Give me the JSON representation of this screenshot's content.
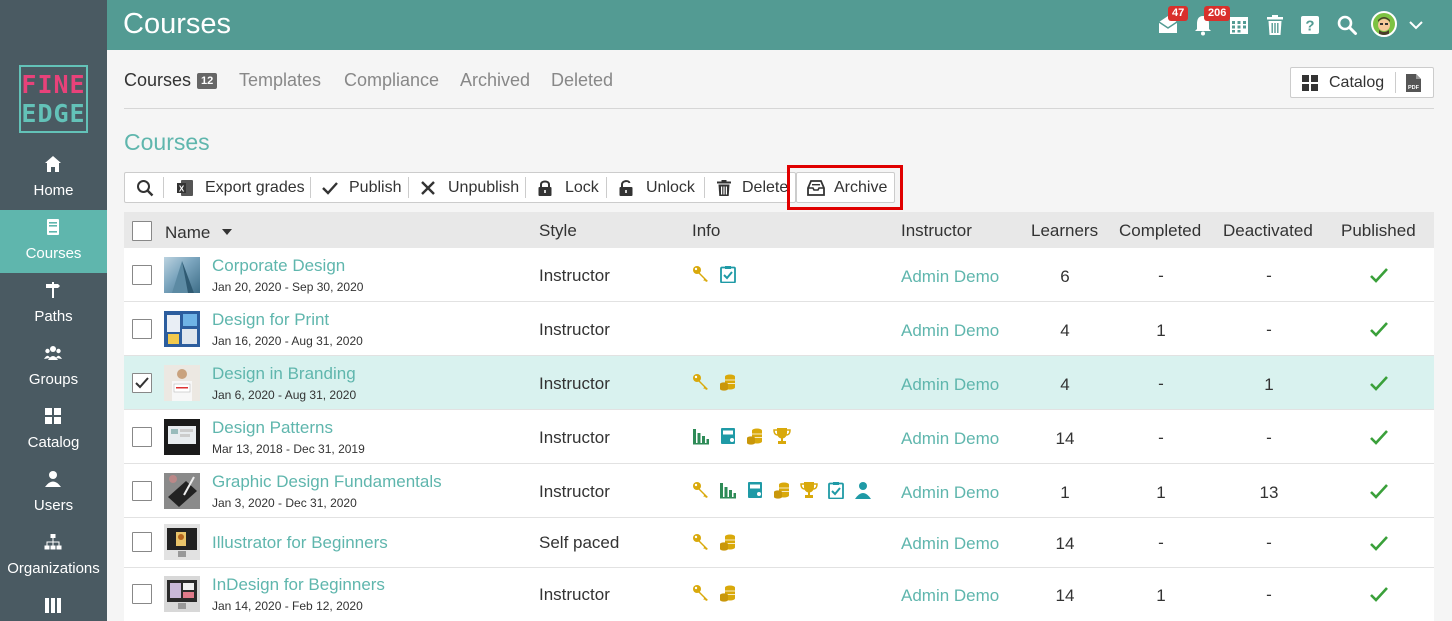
{
  "app": {
    "title": "Courses"
  },
  "logo": {
    "line1": "FINE",
    "line2": "EDGE"
  },
  "sidebar": {
    "items": [
      {
        "label": "Home",
        "icon": "home-icon"
      },
      {
        "label": "Courses",
        "icon": "book-icon",
        "active": true
      },
      {
        "label": "Paths",
        "icon": "signpost-icon"
      },
      {
        "label": "Groups",
        "icon": "users-icon"
      },
      {
        "label": "Catalog",
        "icon": "grid-icon"
      },
      {
        "label": "Users",
        "icon": "user-icon"
      },
      {
        "label": "Organizations",
        "icon": "sitemap-icon"
      }
    ]
  },
  "topbar": {
    "messages_count": "47",
    "notifications_count": "206",
    "icons": [
      "inbox-icon",
      "bell-icon",
      "calendar-icon",
      "trash-icon",
      "help-icon",
      "search-icon",
      "avatar",
      "chevron-down-icon"
    ]
  },
  "tabs": [
    {
      "label": "Courses",
      "count": "12",
      "active": true
    },
    {
      "label": "Templates"
    },
    {
      "label": "Compliance"
    },
    {
      "label": "Archived"
    },
    {
      "label": "Deleted"
    }
  ],
  "catalog_button": {
    "label": "Catalog"
  },
  "section_title": "Courses",
  "toolbar": {
    "export_grades": "Export grades",
    "publish": "Publish",
    "unpublish": "Unpublish",
    "lock": "Lock",
    "unlock": "Unlock",
    "delete": "Delete",
    "archive": "Archive"
  },
  "table": {
    "headers": {
      "name": "Name",
      "style": "Style",
      "info": "Info",
      "instructor": "Instructor",
      "learners": "Learners",
      "completed": "Completed",
      "deactivated": "Deactivated",
      "published": "Published"
    },
    "rows": [
      {
        "name": "Corporate Design",
        "dates": "Jan 20, 2020 - Sep 30, 2020",
        "style": "Instructor",
        "info": [
          "key",
          "clipboard-check"
        ],
        "instructor": "Admin Demo",
        "learners": "6",
        "completed": "-",
        "deactivated": "-",
        "published": true,
        "selected": false
      },
      {
        "name": "Design for Print",
        "dates": "Jan 16, 2020 - Aug 31, 2020",
        "style": "Instructor",
        "info": [],
        "instructor": "Admin Demo",
        "learners": "4",
        "completed": "1",
        "deactivated": "-",
        "published": true,
        "selected": false
      },
      {
        "name": "Design in Branding",
        "dates": "Jan 6, 2020 - Aug 31, 2020",
        "style": "Instructor",
        "info": [
          "key",
          "coins"
        ],
        "instructor": "Admin Demo",
        "learners": "4",
        "completed": "-",
        "deactivated": "1",
        "published": true,
        "selected": true
      },
      {
        "name": "Design Patterns",
        "dates": "Mar 13, 2018 - Dec 31, 2019",
        "style": "Instructor",
        "info": [
          "bar-chart",
          "calendar-book",
          "coins",
          "trophy"
        ],
        "instructor": "Admin Demo",
        "learners": "14",
        "completed": "-",
        "deactivated": "-",
        "published": true,
        "selected": false
      },
      {
        "name": "Graphic Design Fundamentals",
        "dates": "Jan 3, 2020 - Dec 31, 2020",
        "style": "Instructor",
        "info": [
          "key",
          "bar-chart",
          "calendar-book",
          "coins",
          "trophy",
          "clipboard-check",
          "person"
        ],
        "instructor": "Admin Demo",
        "learners": "1",
        "completed": "1",
        "deactivated": "13",
        "published": true,
        "selected": false
      },
      {
        "name": "Illustrator for Beginners",
        "dates": "",
        "style": "Self paced",
        "info": [
          "key",
          "coins"
        ],
        "instructor": "Admin Demo",
        "learners": "14",
        "completed": "-",
        "deactivated": "-",
        "published": true,
        "selected": false
      },
      {
        "name": "InDesign for Beginners",
        "dates": "Jan 14, 2020 - Feb 12, 2020",
        "style": "Instructor",
        "info": [
          "key",
          "coins"
        ],
        "instructor": "Admin Demo",
        "learners": "14",
        "completed": "1",
        "deactivated": "-",
        "published": true,
        "selected": false
      }
    ]
  },
  "colors": {
    "teal": "#5fb6ad",
    "topbar": "#539b93",
    "sidebar": "#4a5a62",
    "gold": "#d9a90b",
    "green_icon": "#2e8b57",
    "check_green": "#3aa03a",
    "highlight": "#e00000"
  }
}
